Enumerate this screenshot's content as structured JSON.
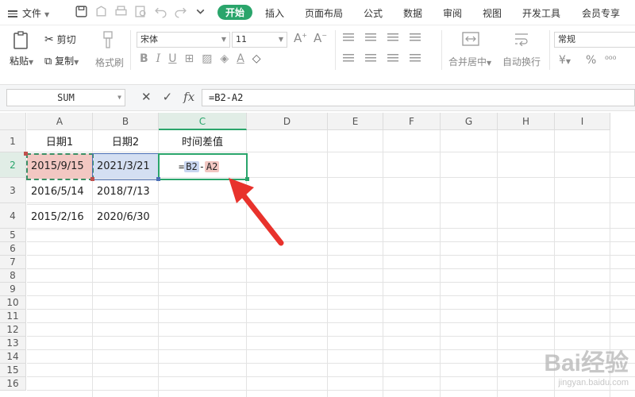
{
  "menubar": {
    "file_label": "文件",
    "tabs": [
      "开始",
      "插入",
      "页面布局",
      "公式",
      "数据",
      "审阅",
      "视图",
      "开发工具",
      "会员专享"
    ]
  },
  "ribbon": {
    "paste_label": "粘贴",
    "cut_label": "剪切",
    "copy_label": "复制",
    "format_painter_label": "格式刷",
    "font_name": "宋体",
    "font_size": "11",
    "merge_center_label": "合并居中",
    "wrap_text_label": "自动换行",
    "number_format": "常规",
    "currency_symbol": "¥",
    "percent_symbol": "%"
  },
  "formula_bar": {
    "name_box": "SUM",
    "cancel_icon": "close-icon",
    "confirm_icon": "check-icon",
    "fx_label": "fx",
    "formula": "=B2-A2"
  },
  "sheet": {
    "columns": [
      "A",
      "B",
      "C",
      "D",
      "E",
      "F",
      "G",
      "H",
      "I"
    ],
    "rows": [
      "1",
      "2",
      "3",
      "4",
      "5",
      "6",
      "7",
      "8",
      "9",
      "10",
      "11",
      "12",
      "13",
      "14",
      "15",
      "16"
    ],
    "header_row": [
      "日期1",
      "日期2",
      "时间差值"
    ],
    "data_rows": [
      [
        "2015/9/15",
        "2021/3/21"
      ],
      [
        "2016/5/14",
        "2018/7/13"
      ],
      [
        "2015/2/16",
        "2020/6/30"
      ]
    ],
    "editing_cell": {
      "prefix": "=",
      "ref1": "B2",
      "op": "-",
      "ref2": "A2"
    },
    "colors": {
      "accent": "#2aa56b",
      "ref_a2_fill": "#f2c7c2",
      "ref_b2_fill": "#d4dff2",
      "arrow": "#e8322c"
    }
  },
  "watermark": {
    "main": "Bai经验",
    "sub": "jingyan.baidu.com"
  }
}
